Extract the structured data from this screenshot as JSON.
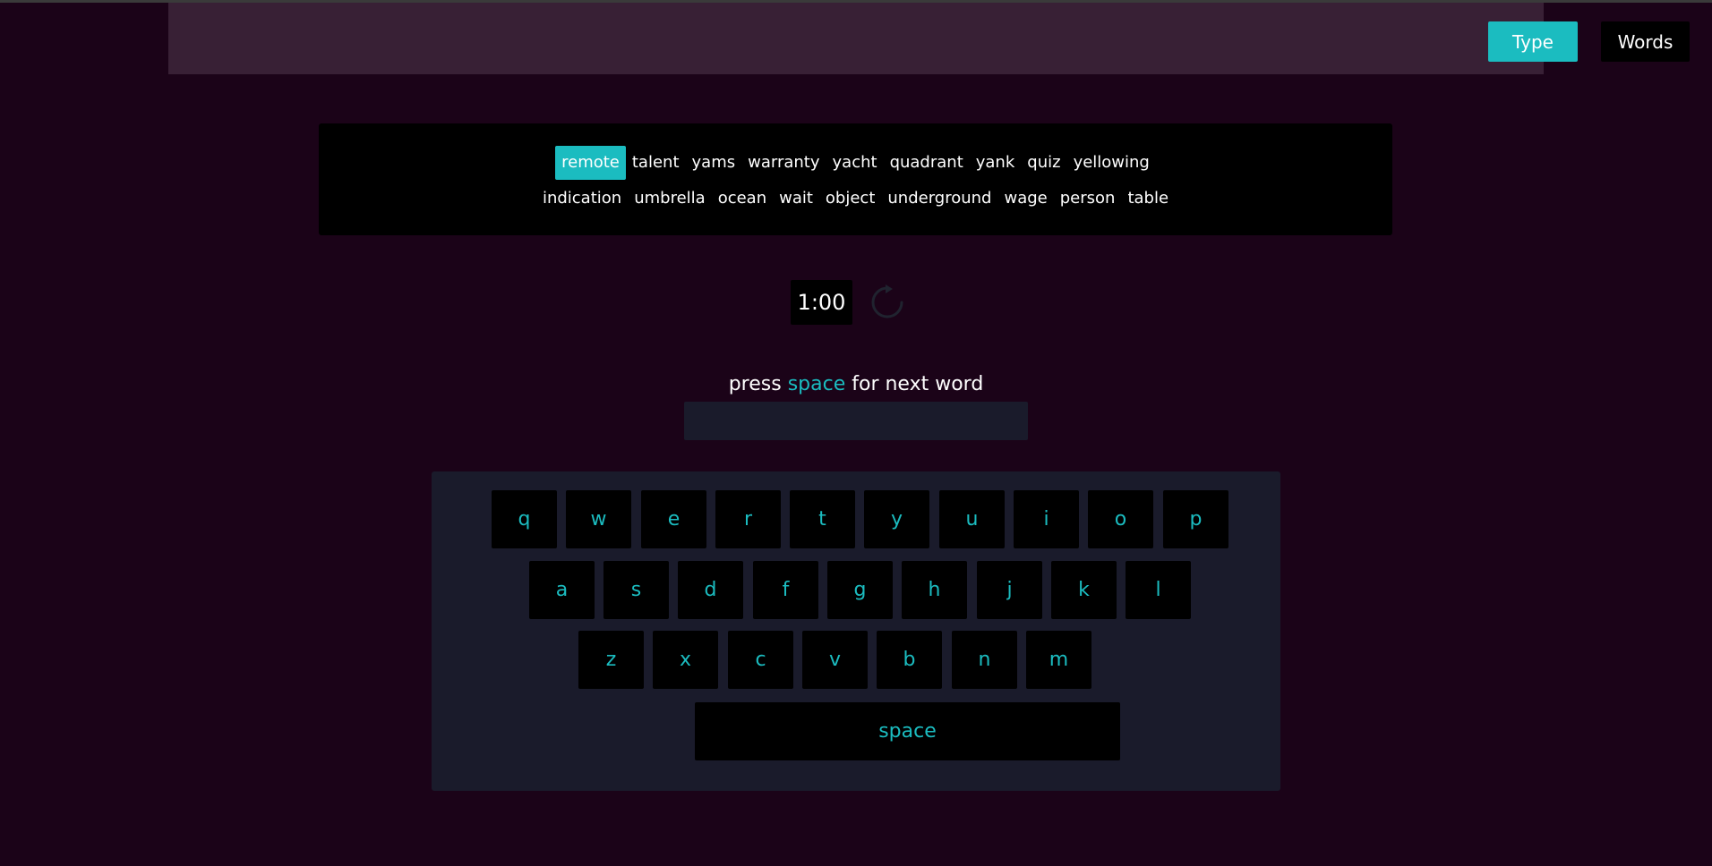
{
  "header": {
    "type_button": "Type",
    "words_button": "Words"
  },
  "words": {
    "row1": [
      "remote",
      "talent",
      "yams",
      "warranty",
      "yacht",
      "quadrant",
      "yank",
      "quiz",
      "yellowing"
    ],
    "row2": [
      "indication",
      "umbrella",
      "ocean",
      "wait",
      "object",
      "underground",
      "wage",
      "person",
      "table"
    ],
    "active_index": 0
  },
  "timer": {
    "value": "1:00"
  },
  "hint": {
    "prefix": "press",
    "key": "space",
    "suffix": "for next word"
  },
  "input": {
    "value": "",
    "placeholder": ""
  },
  "keyboard": {
    "row1": [
      "q",
      "w",
      "e",
      "r",
      "t",
      "y",
      "u",
      "i",
      "o",
      "p"
    ],
    "row2": [
      "a",
      "s",
      "d",
      "f",
      "g",
      "h",
      "j",
      "k",
      "l"
    ],
    "row3": [
      "z",
      "x",
      "c",
      "v",
      "b",
      "n",
      "m"
    ],
    "space": "space"
  },
  "colors": {
    "background": "#1b0318",
    "header": "#382035",
    "accent": "#1bbcc0",
    "panel": "#000000",
    "keyboard_bg": "#1a1b2b"
  },
  "icons": {
    "reset": "refresh-icon"
  }
}
